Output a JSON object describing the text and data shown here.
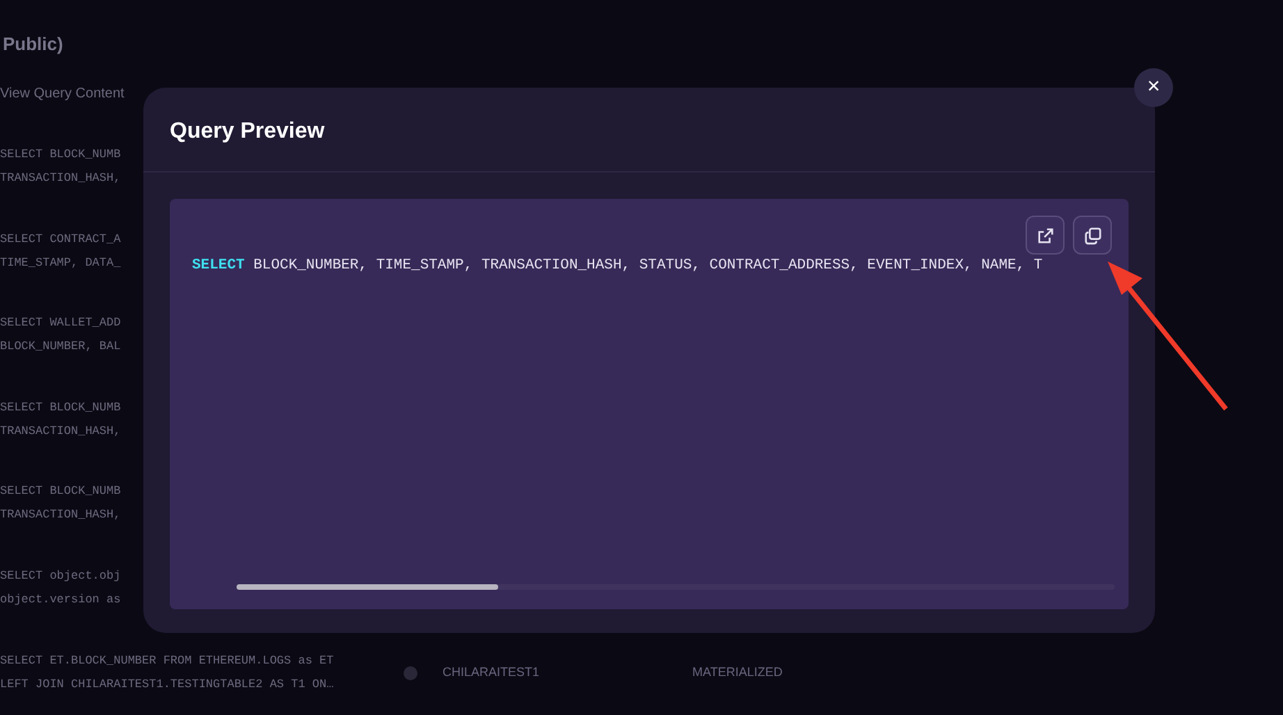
{
  "background": {
    "heading": "Public)",
    "column_label": "View Query Content",
    "rows": [
      {
        "line_1": "SELECT BLOCK_NUMB",
        "line_2": "TRANSACTION_HASH,"
      },
      {
        "line_1": "SELECT CONTRACT_A",
        "line_2": "TIME_STAMP, DATA_"
      },
      {
        "line_1": "SELECT WALLET_ADD",
        "line_2": "BLOCK_NUMBER, BAL"
      },
      {
        "line_1": "SELECT BLOCK_NUMB",
        "line_2": "TRANSACTION_HASH,"
      },
      {
        "line_1": "SELECT BLOCK_NUMB",
        "line_2": "TRANSACTION_HASH,"
      },
      {
        "line_1": "SELECT object.obj",
        "line_2": "object.version as"
      },
      {
        "line_1": "SELECT ET.BLOCK_NUMBER FROM ETHEREUM.LOGS as ET",
        "line_2": "LEFT JOIN CHILARAITEST1.TESTINGTABLE2 AS T1 ON…",
        "schema": "CHILARAITEST1",
        "type": "MATERIALIZED"
      }
    ]
  },
  "modal": {
    "title": "Query Preview",
    "close": "×",
    "code": {
      "keyword": "SELECT",
      "rest": " BLOCK_NUMBER, TIME_STAMP, TRANSACTION_HASH, STATUS, CONTRACT_ADDRESS, EVENT_INDEX, NAME, T"
    }
  }
}
